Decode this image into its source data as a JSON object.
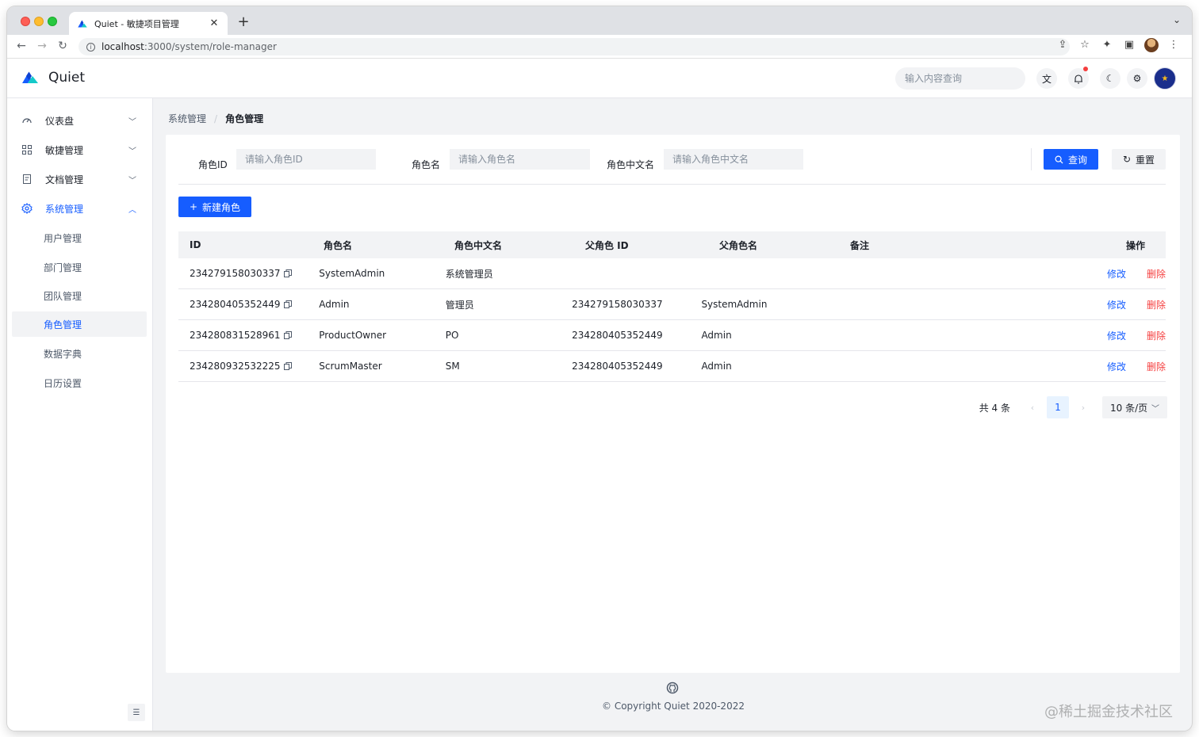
{
  "browser": {
    "tab_title": "Quiet - 敏捷项目管理",
    "url_host": "localhost",
    "url_rest": ":3000/system/role-manager"
  },
  "header": {
    "brand": "Quiet",
    "search_placeholder": "输入内容查询"
  },
  "sidebar": {
    "items": [
      {
        "label": "仪表盘",
        "icon": "dashboard-icon",
        "expanded": false
      },
      {
        "label": "敏捷管理",
        "icon": "grid-icon",
        "expanded": false
      },
      {
        "label": "文档管理",
        "icon": "document-icon",
        "expanded": false
      },
      {
        "label": "系统管理",
        "icon": "gear-icon",
        "expanded": true
      }
    ],
    "sub_items": [
      "用户管理",
      "部门管理",
      "团队管理",
      "角色管理",
      "数据字典",
      "日历设置"
    ],
    "active_sub": "角色管理"
  },
  "breadcrumb": {
    "parent": "系统管理",
    "sep": "/",
    "current": "角色管理"
  },
  "filters": {
    "role_id_label": "角色ID",
    "role_id_placeholder": "请输入角色ID",
    "role_name_label": "角色名",
    "role_name_placeholder": "请输入角色名",
    "role_cn_label": "角色中文名",
    "role_cn_placeholder": "请输入角色中文名",
    "query_label": "查询",
    "reset_label": "重置"
  },
  "actions": {
    "new_role": "新建角色"
  },
  "table": {
    "headers": [
      "ID",
      "角色名",
      "角色中文名",
      "父角色 ID",
      "父角色名",
      "备注",
      "操作"
    ],
    "rows": [
      {
        "id": "234279158030337",
        "name": "SystemAdmin",
        "cn": "系统管理员",
        "pid": "",
        "pname": "",
        "remark": "",
        "edit": "修改",
        "del": "删除"
      },
      {
        "id": "234280405352449",
        "name": "Admin",
        "cn": "管理员",
        "pid": "234279158030337",
        "pname": "SystemAdmin",
        "remark": "",
        "edit": "修改",
        "del": "删除"
      },
      {
        "id": "234280831528961",
        "name": "ProductOwner",
        "cn": "PO",
        "pid": "234280405352449",
        "pname": "Admin",
        "remark": "",
        "edit": "修改",
        "del": "删除"
      },
      {
        "id": "234280932532225",
        "name": "ScrumMaster",
        "cn": "SM",
        "pid": "234280405352449",
        "pname": "Admin",
        "remark": "",
        "edit": "修改",
        "del": "删除"
      }
    ]
  },
  "pagination": {
    "total": "共 4 条",
    "current_page": "1",
    "page_size": "10 条/页"
  },
  "footer": {
    "copyright": "© Copyright Quiet 2020-2022"
  },
  "watermark": "@稀土掘金技术社区",
  "colors": {
    "primary": "#165dff",
    "danger": "#f53f3f",
    "bg": "#f2f3f5"
  }
}
